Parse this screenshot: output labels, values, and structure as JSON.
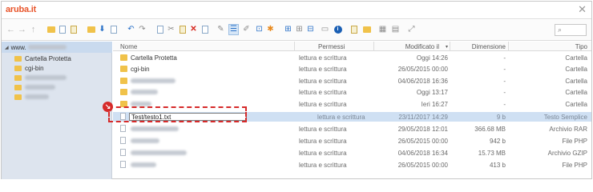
{
  "app": {
    "logo": "aruba.it",
    "close_glyph": "✕"
  },
  "toolbar": {
    "search_placeholder": "",
    "search_icon_glyph": "⌕"
  },
  "tree": {
    "root_label": "www.",
    "items": [
      {
        "label": "Cartella Protetta"
      },
      {
        "label": "cgi-bin"
      }
    ]
  },
  "list": {
    "columns": {
      "name": "Nome",
      "permissions": "Permessi",
      "modified": "Modificato il",
      "size": "Dimensione",
      "type": "Tipo"
    },
    "rows": [
      {
        "name": "Cartella Protetta",
        "permissions": "lettura e scrittura",
        "modified": "Oggi 14:26",
        "size": "-",
        "type": "Cartella"
      },
      {
        "name": "cgi-bin",
        "permissions": "lettura e scrittura",
        "modified": "26/05/2015 00:00",
        "size": "-",
        "type": "Cartella"
      },
      {
        "name": "",
        "permissions": "lettura e scrittura",
        "modified": "04/06/2018 16:36",
        "size": "-",
        "type": "Cartella"
      },
      {
        "name": "",
        "permissions": "lettura e scrittura",
        "modified": "Oggi 13:17",
        "size": "-",
        "type": "Cartella"
      },
      {
        "name": "",
        "permissions": "lettura e scrittura",
        "modified": "Ieri 16:27",
        "size": "-",
        "type": "Cartella"
      },
      {
        "name": "Test/testo1.txt",
        "permissions": "lettura e scrittura",
        "modified": "23/11/2017 14:29",
        "size": "9 b",
        "type": "Testo Semplice"
      },
      {
        "name": "",
        "permissions": "lettura e scrittura",
        "modified": "29/05/2018 12:01",
        "size": "366.68 MB",
        "type": "Archivio RAR"
      },
      {
        "name": "",
        "permissions": "lettura e scrittura",
        "modified": "26/05/2015 00:00",
        "size": "942 b",
        "type": "File PHP"
      },
      {
        "name": "",
        "permissions": "lettura e scrittura",
        "modified": "04/06/2018 16:34",
        "size": "15.73 MB",
        "type": "Archivio GZIP"
      },
      {
        "name": "",
        "permissions": "lettura e scrittura",
        "modified": "26/05/2015 00:00",
        "size": "413 b",
        "type": "File PHP"
      }
    ]
  },
  "annotation": {
    "badge_glyph": "↘"
  },
  "colors": {
    "accent": "#d62a2a",
    "brand": "#e8542a",
    "selection": "#cfe0f3"
  }
}
